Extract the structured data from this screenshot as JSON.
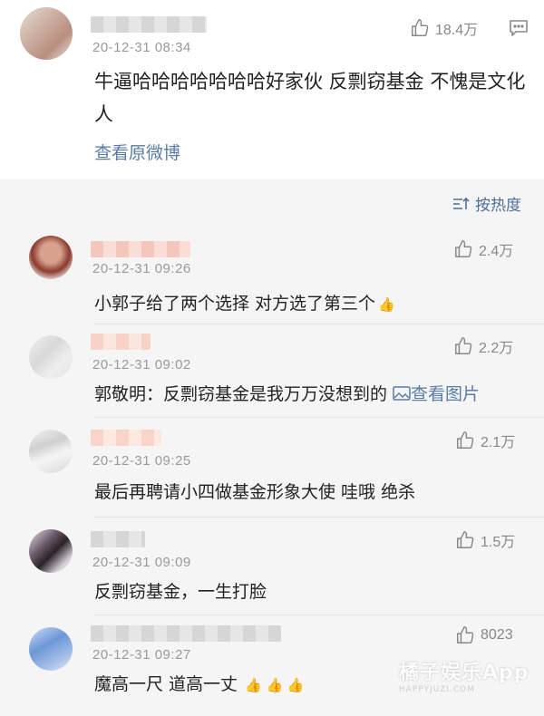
{
  "top_comment": {
    "timestamp": "20-12-31 08:34",
    "likes": "18.4万",
    "text": "牛逼哈哈哈哈哈哈哈好家伙 反剽窃基金 不愧是文化人",
    "view_original": "查看原微博"
  },
  "sort": {
    "label": "按热度"
  },
  "comments": [
    {
      "timestamp": "20-12-31 09:26",
      "likes": "2.4万",
      "text": "小郭子给了两个选择 对方选了第三个",
      "thumbs": "👍"
    },
    {
      "timestamp": "20-12-31 09:02",
      "likes": "2.2万",
      "text": "郭敬明：反剽窃基金是我万万没想到的 ",
      "link": "查看图片"
    },
    {
      "timestamp": "20-12-31 09:25",
      "likes": "2.1万",
      "text": "最后再聘请小四做基金形象大使 哇哦 绝杀"
    },
    {
      "timestamp": "20-12-31 09:09",
      "likes": "1.5万",
      "text": "反剽窃基金，一生打脸"
    },
    {
      "timestamp": "20-12-31 09:27",
      "likes": "8023",
      "text": "魔高一尺 道高一丈",
      "thumbs": "👍 👍 👍"
    }
  ],
  "watermark": {
    "main": "橘子娱乐App",
    "sub": "HAPPYJUZI.COM"
  },
  "icons": {
    "like": "thumb-up-icon",
    "more": "more-menu-icon",
    "sort": "sort-icon",
    "image": "image-icon"
  },
  "colors": {
    "link": "#5b7ba5",
    "text": "#222222",
    "meta": "#9a9a9a"
  }
}
